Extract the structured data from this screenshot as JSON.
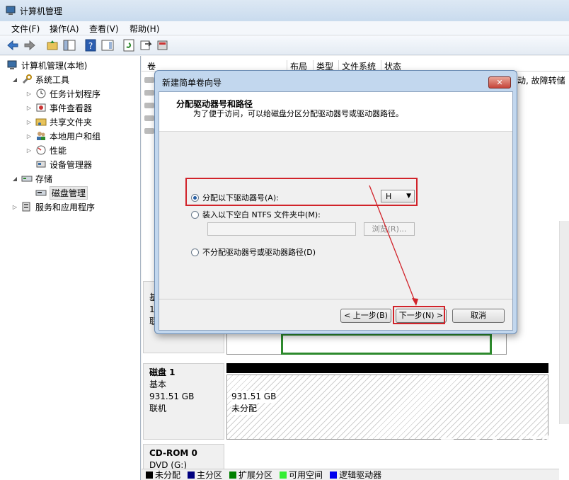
{
  "window": {
    "title": "计算机管理"
  },
  "menu": [
    "文件(F)",
    "操作(A)",
    "查看(V)",
    "帮助(H)"
  ],
  "tree": {
    "root": "计算机管理(本地)",
    "system_tools": "系统工具",
    "task_scheduler": "任务计划程序",
    "event_viewer": "事件查看器",
    "shared_folders": "共享文件夹",
    "local_users": "本地用户和组",
    "performance": "性能",
    "device_manager": "设备管理器",
    "storage": "存储",
    "disk_management": "磁盘管理",
    "services_apps": "服务和应用程序"
  },
  "volume_list": {
    "headers": [
      "卷",
      "布局",
      "类型",
      "文件系统",
      "状态"
    ],
    "status_text": "动, 故障转储"
  },
  "disks": {
    "disk0_partial": [
      "基",
      "1",
      "联"
    ],
    "disk1": {
      "name": "磁盘 1",
      "type": "基本",
      "size": "931.51 GB",
      "status": "联机",
      "partition_size": "931.51 GB",
      "partition_label": "未分配"
    },
    "cdrom": {
      "name": "CD-ROM 0",
      "drive": "DVD (G:)"
    }
  },
  "legend": [
    {
      "label": "未分配",
      "color": "#000000"
    },
    {
      "label": "主分区",
      "color": "#00007f"
    },
    {
      "label": "扩展分区",
      "color": "#008000"
    },
    {
      "label": "可用空间",
      "color": "#33ee33"
    },
    {
      "label": "逻辑驱动器",
      "color": "#0000ee"
    }
  ],
  "dialog": {
    "title": "新建简单卷向导",
    "close": "✕",
    "heading": "分配驱动器号和路径",
    "subheading": "为了便于访问，可以给磁盘分区分配驱动器号或驱动器路径。",
    "option_assign": "分配以下驱动器号(A):",
    "drive_letter": "H",
    "option_mount": "装入以下空白 NTFS 文件夹中(M):",
    "browse": "浏览(R)...",
    "option_none": "不分配驱动器号或驱动器路径(D)",
    "back": "< 上一步(B)",
    "next": "下一步(N) >",
    "cancel": "取消"
  },
  "watermark": {
    "brand": "Baidu经验",
    "url": "jingyan.baidu.com"
  }
}
